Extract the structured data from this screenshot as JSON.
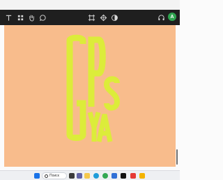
{
  "toolbar": {
    "left_tools": [
      "text-icon",
      "grid-icon",
      "hand-icon",
      "comment-icon"
    ],
    "center_tools": [
      "frame-icon",
      "shapes-icon",
      "contrast-icon"
    ],
    "right_tools": [
      "headphones-icon"
    ],
    "avatar_initial": "A",
    "avatar_color": "#2ea44f"
  },
  "canvas": {
    "background": "#f8bc8c",
    "artwork": {
      "color": "#dcec3a",
      "letters": [
        "G",
        "P",
        "S",
        "Y",
        "A"
      ]
    }
  },
  "taskbar": {
    "search_label": "Поиск",
    "apps": [
      "start-icon",
      "search-box",
      "task-view-icon",
      "chat-icon",
      "files-icon",
      "edge-icon",
      "chrome-icon",
      "store-icon",
      "app-icon",
      "yandex-icon",
      "notes-icon"
    ]
  }
}
